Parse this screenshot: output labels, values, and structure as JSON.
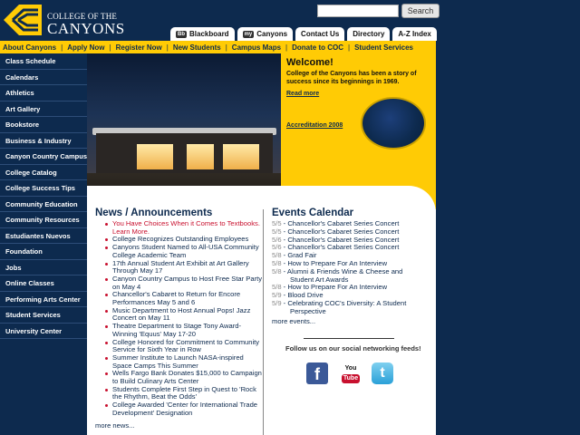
{
  "header": {
    "logo_line1": "COLLEGE OF THE",
    "logo_line2": "CANYONS",
    "search_placeholder": "",
    "search_button": "Search",
    "tabs": [
      {
        "label": "Blackboard",
        "badge": "Bb"
      },
      {
        "label": "Canyons",
        "badge": "my"
      },
      {
        "label": "Contact Us"
      },
      {
        "label": "Directory"
      },
      {
        "label": "A-Z Index"
      }
    ]
  },
  "topnav": [
    "About Canyons",
    "Apply Now",
    "Register Now",
    "New Students",
    "Campus Maps",
    "Donate to COC",
    "Student Services"
  ],
  "sidebar": [
    "Class Schedule",
    "Calendars",
    "Athletics",
    "Art Gallery",
    "Bookstore",
    "Business & Industry",
    "Canyon Country Campus",
    "College Catalog",
    "College Success Tips",
    "Community Education",
    "Community Resources",
    "Estudiantes Nuevos",
    "Foundation",
    "Jobs",
    "Online Classes",
    "Performing Arts Center",
    "Student Services",
    "University Center"
  ],
  "welcome": {
    "title": "Welcome!",
    "text": "College of the Canyons has been a story of success since its beginnings in 1969.",
    "read_more": "Read more",
    "accreditation": "Accreditation 2008"
  },
  "news": {
    "title": "News / Announcements",
    "items": [
      "You Have Choices When it Comes to Textbooks. Learn More.",
      "College Recognizes Outstanding Employees",
      "Canyons Student Named to All-USA Community College Academic Team",
      "17th Annual Student Art Exhibit at Art Gallery Through May 17",
      "Canyon Country Campus to Host Free Star Party on May 4",
      "Chancellor's Cabaret to Return for Encore Performances May 5 and 6",
      "Music Department to Host Annual Pops! Jazz Concert on May 11",
      "Theatre Department to Stage Tony Award-Winning 'Equus' May 17-20",
      "College Honored for Commitment to Community Service for Sixth Year in Row",
      "Summer Institute to Launch NASA-inspired Space Camps This Summer",
      "Wells Fargo Bank Donates $15,000 to Campaign to Build Culinary Arts Center",
      "Students Complete First Step in Quest to 'Rock the Rhythm, Beat the Odds'",
      "College Awarded 'Center for International Trade Development' Designation"
    ],
    "more": "more news..."
  },
  "events": {
    "title": "Events Calendar",
    "items": [
      {
        "date": "5/5",
        "text": "Chancellor's Cabaret Series Concert"
      },
      {
        "date": "5/5",
        "text": "Chancellor's Cabaret Series Concert"
      },
      {
        "date": "5/6",
        "text": "Chancellor's Cabaret Series Concert"
      },
      {
        "date": "5/6",
        "text": "Chancellor's Cabaret Series Concert"
      },
      {
        "date": "5/8",
        "text": "Grad Fair"
      },
      {
        "date": "5/8",
        "text": "How to Prepare For An Interview"
      },
      {
        "date": "5/8",
        "text": "Alumni & Friends Wine & Cheese and Student Art Awards"
      },
      {
        "date": "5/8",
        "text": "How to Prepare For An Interview"
      },
      {
        "date": "5/9",
        "text": "Blood Drive"
      },
      {
        "date": "5/9",
        "text": "Celebrating COC's Diversity: A Student Perspective"
      }
    ],
    "more": "more events..."
  },
  "social": {
    "label": "Follow us on our social networking feeds!",
    "facebook": "f",
    "youtube_top": "You",
    "youtube_bottom": "Tube",
    "twitter": "t"
  },
  "colors": {
    "navy": "#0d2a4e",
    "gold": "#ffcb05",
    "news_red": "#c8102e"
  }
}
